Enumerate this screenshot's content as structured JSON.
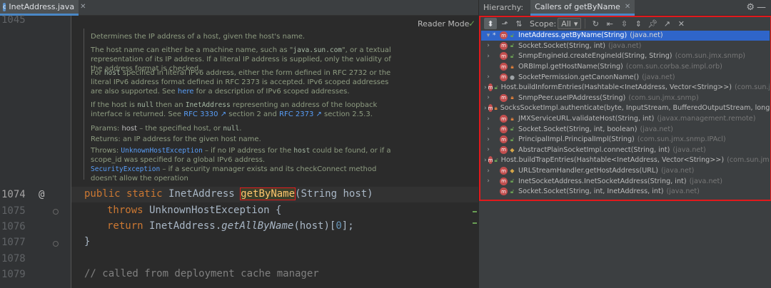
{
  "editor": {
    "tab_label": "InetAddress.java",
    "reader_mode": "Reader Mode",
    "line_numbers": [
      "1045",
      "1074",
      "1075",
      "1076",
      "1077",
      "1078",
      "1079"
    ],
    "at_marker": "@",
    "doc": {
      "p1": "Determines the IP address of a host, given the host's name.",
      "p2a": "The host name can either be a machine name, such as \"",
      "p2code": "java.sun.com",
      "p2b": "\", or a textual representation of its IP address. If a literal IP address is supplied, only the validity of the address format is checked.",
      "p3a": "For ",
      "p3code": "host",
      "p3b": " specified in literal IPv6 address, either the form defined in RFC 2732 or the literal IPv6 address format defined in RFC 2373 is accepted. IPv6 scoped addresses are also supported. See ",
      "p3link": "here",
      "p3c": " for a description of IPv6 scoped addresses.",
      "p4a": "If the host is ",
      "p4code1": "null",
      "p4b": " then an ",
      "p4code2": "InetAddress",
      "p4c": " representing an address of the loopback interface is returned. See ",
      "p4link1": "RFC 3330 ↗",
      "p4d": " section 2 and ",
      "p4link2": "RFC 2373 ↗",
      "p4e": " section 2.5.3.",
      "params_label": "Params:",
      "params_val_a": "host",
      "params_val_b": " – the specified host, or ",
      "params_val_code": "null",
      "params_val_c": ".",
      "returns_label": "Returns:",
      "returns_val": "an IP address for the given host name.",
      "throws_label": "Throws:",
      "throws1_code": "UnknownHostException",
      "throws1_a": " – if no IP address for the ",
      "throws1_code2": "host",
      "throws1_b": " could be found, or if a scope_id was specified for a global IPv6 address.",
      "throws2_code": "SecurityException",
      "throws2_a": " – if a security manager exists and its checkConnect method doesn't allow the operation"
    },
    "code": {
      "l1074_kw": "public static ",
      "l1074_type": "InetAddress ",
      "l1074_name": "getByName",
      "l1074_rest": "(String host)",
      "l1075_kw": "throws ",
      "l1075_rest": "UnknownHostException {",
      "l1076_kw": "return ",
      "l1076_a": "InetAddress.",
      "l1076_call": "getAllByName",
      "l1076_b": "(host)[",
      "l1076_num": "0",
      "l1076_c": "];",
      "l1077": "}",
      "l1079": "// called from deployment cache manager"
    }
  },
  "hierarchy": {
    "title": "Hierarchy:",
    "tab_label": "Callers of getByName",
    "scope_label": "Scope:",
    "scope_value": "All",
    "items": [
      {
        "method": "InetAddress.getByName(String)",
        "pkg": "(java.net)",
        "vis": "pub",
        "expanded": true,
        "selected": true
      },
      {
        "method": "Socket.Socket(String, int)",
        "pkg": "(java.net)",
        "vis": "pub"
      },
      {
        "method": "SnmpEngineId.createEngineId(String, String)",
        "pkg": "(com.sun.jmx.snmp)",
        "vis": "pub"
      },
      {
        "method": "ORBImpl.getHostName(String)",
        "pkg": "(com.sun.corba.se.impl.orb)",
        "vis": "priv",
        "leaf": true
      },
      {
        "method": "SocketPermission.getCanonName()",
        "pkg": "(java.net)",
        "vis": "pkg"
      },
      {
        "method": "Host.buildInformEntries(Hashtable<InetAddress, Vector<String>>)",
        "pkg": "(com.sun.jmx.s",
        "vis": "pub"
      },
      {
        "method": "SnmpPeer.useIPAddress(String)",
        "pkg": "(com.sun.jmx.snmp)",
        "vis": "priv"
      },
      {
        "method": "SocksSocketImpl.authenticate(byte, InputStream, BufferedOutputStream, long)",
        "pkg": "(ja",
        "vis": "priv"
      },
      {
        "method": "JMXServiceURL.validateHost(String, int)",
        "pkg": "(javax.management.remote)",
        "vis": "priv"
      },
      {
        "method": "Socket.Socket(String, int, boolean)",
        "pkg": "(java.net)",
        "vis": "pub"
      },
      {
        "method": "PrincipalImpl.PrincipalImpl(String)",
        "pkg": "(com.sun.jmx.snmp.IPAcl)",
        "vis": "pub"
      },
      {
        "method": "AbstractPlainSocketImpl.connect(String, int)",
        "pkg": "(java.net)",
        "vis": "prot"
      },
      {
        "method": "Host.buildTrapEntries(Hashtable<InetAddress, Vector<String>>)",
        "pkg": "(com.sun.jmx.sn",
        "vis": "pub"
      },
      {
        "method": "URLStreamHandler.getHostAddress(URL)",
        "pkg": "(java.net)",
        "vis": "prot"
      },
      {
        "method": "InetSocketAddress.InetSocketAddress(String, int)",
        "pkg": "(java.net)",
        "vis": "pub"
      },
      {
        "method": "Socket.Socket(String, int, InetAddress, int)",
        "pkg": "(java.net)",
        "vis": "pub",
        "leaf": true
      }
    ]
  },
  "colors": {
    "selection": "#2f65ca",
    "highlight_border": "#e2191c",
    "keyword": "#cc7832",
    "method_name": "#ffc66d"
  }
}
